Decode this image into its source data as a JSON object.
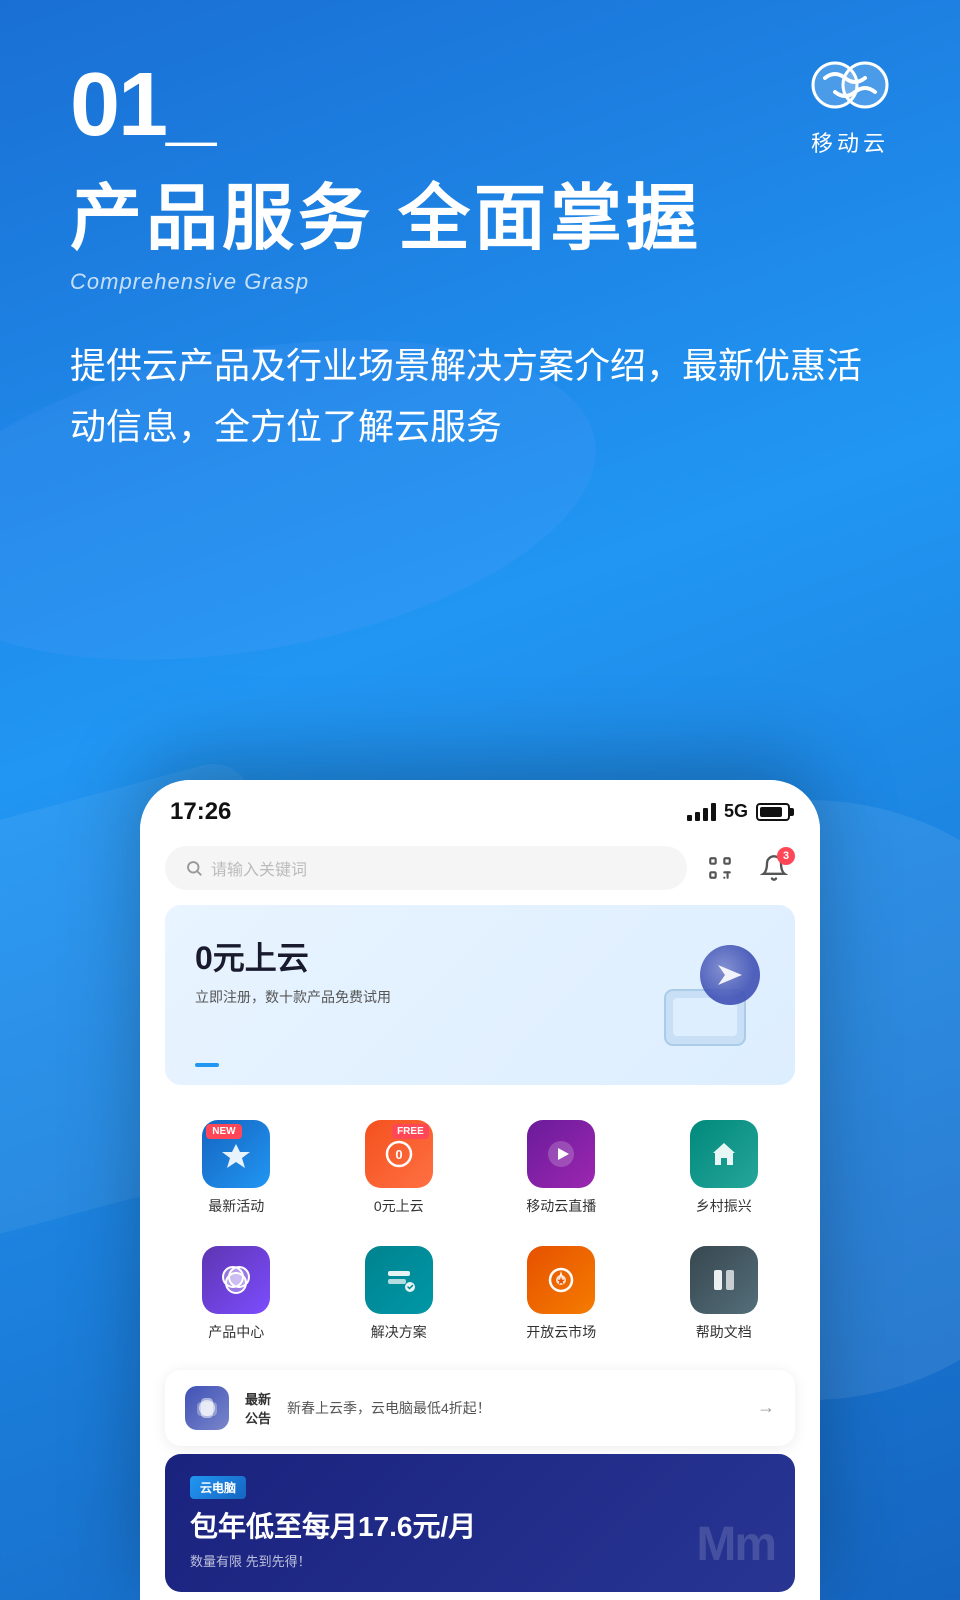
{
  "background": {
    "gradient_start": "#1a6fd4",
    "gradient_end": "#1565c0"
  },
  "header": {
    "step_number": "01_",
    "logo_text": "移动云"
  },
  "title_section": {
    "main_title": "产品服务 全面掌握",
    "sub_title": "Comprehensive Grasp",
    "description": "提供云产品及行业场景解决方案介绍，最新优惠活动信息，全方位了解云服务"
  },
  "phone": {
    "status_bar": {
      "time": "17:26",
      "signal": "5G"
    },
    "search": {
      "placeholder": "请输入关键词",
      "notification_count": "3"
    },
    "banner": {
      "title": "0元上云",
      "description": "立即注册，数十款产品免费试用"
    },
    "icons": [
      {
        "label": "最新活动",
        "type": "activity",
        "badge": "NEW"
      },
      {
        "label": "0元上云",
        "type": "free",
        "badge": "FREE"
      },
      {
        "label": "移动云直播",
        "type": "live"
      },
      {
        "label": "乡村振兴",
        "type": "rural"
      },
      {
        "label": "产品中心",
        "type": "product"
      },
      {
        "label": "解决方案",
        "type": "solution"
      },
      {
        "label": "开放云市场",
        "type": "market"
      },
      {
        "label": "帮助文档",
        "type": "help"
      }
    ],
    "announcement": {
      "label": "最新\n公告",
      "text": "新春上云季，云电脑最低4折起！"
    },
    "cloud_pc": {
      "tag": "云电脑",
      "title": "包年低至每月17.6元/月",
      "description": "数量有限 先到先得！"
    }
  }
}
